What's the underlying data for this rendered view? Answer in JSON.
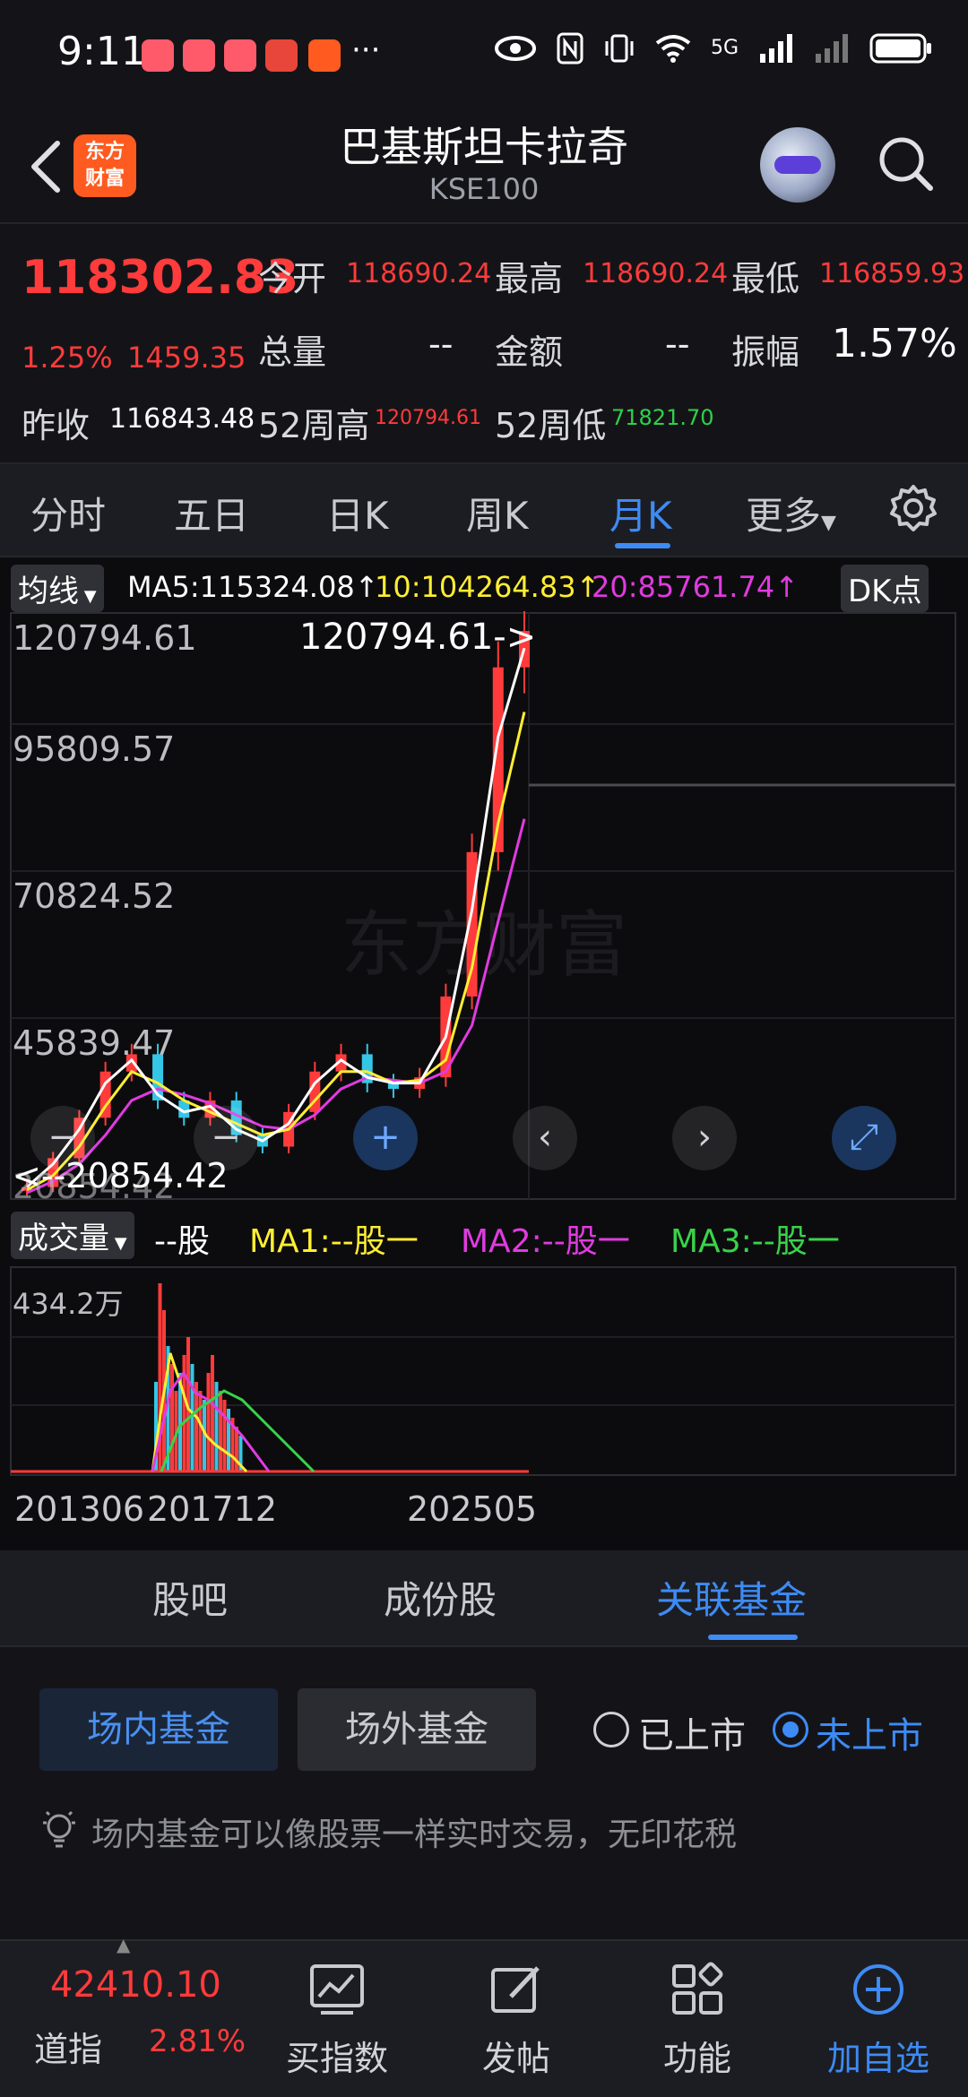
{
  "status_bar": {
    "time": "9:11",
    "more": "···",
    "net": "5G"
  },
  "header": {
    "back_label": "<",
    "logo_line1": "东方",
    "logo_line2": "财富",
    "title": "巴基斯坦卡拉奇",
    "subtitle": "KSE100"
  },
  "quote": {
    "price": "118302.83",
    "change_pct": "1.25%",
    "change_amt": "1459.35",
    "fields": [
      {
        "label": "今开",
        "value": "118690.24"
      },
      {
        "label": "最高",
        "value": "118690.24"
      },
      {
        "label": "最低",
        "value": "116859.93"
      },
      {
        "label": "总量",
        "value": "--"
      },
      {
        "label": "金额",
        "value": "--"
      },
      {
        "label": "振幅",
        "value": "1.57%"
      },
      {
        "label": "昨收",
        "value": "116843.48"
      },
      {
        "label": "52周高",
        "value": "120794.61"
      },
      {
        "label": "52周低",
        "value": "71821.70"
      }
    ]
  },
  "period_tabs": [
    "分时",
    "五日",
    "日K",
    "周K",
    "月K",
    "更多"
  ],
  "chart": {
    "ma_selector": "均线",
    "ma5": "MA5:115324.08↑",
    "ma10": "10:104264.83↑",
    "ma20": "20:85761.74↑",
    "dk_button": "DK点",
    "y_labels": [
      "120794.61",
      "95809.57",
      "70824.52",
      "45839.47",
      "20854.42"
    ],
    "high_marker": "120794.61->",
    "low_marker": "<--20854.42",
    "watermark": "东方财富",
    "volume_selector": "成交量",
    "vol_unit": "--股",
    "vol_ma1": "MA1:--股一",
    "vol_ma2": "MA2:--股一",
    "vol_ma3": "MA3:--股一",
    "vol_max": "434.2万",
    "x_labels": [
      "201306",
      "201712",
      "202505"
    ],
    "colors": {
      "up": "#ff3b3b",
      "down": "#35c6e6",
      "ma5": "#ffffff",
      "ma10": "#ffee33",
      "ma20": "#e03be0",
      "vol_ma3": "#39d34a"
    }
  },
  "section_tabs": [
    "股吧",
    "成份股",
    "关联基金"
  ],
  "fund": {
    "btn_onsite": "场内基金",
    "btn_offsite": "场外基金",
    "radio_listed": "已上市",
    "radio_unlisted": "未上市",
    "tip": "场内基金可以像股票一样实时交易，无印花税"
  },
  "bottom_nav": {
    "index_value": "42410.10",
    "index_name": "道指",
    "index_change": "2.81%",
    "items": [
      "买指数",
      "发帖",
      "功能",
      "加自选"
    ]
  },
  "chart_data": {
    "type": "candlestick",
    "title": "",
    "ylim": [
      20854.42,
      120794.61
    ],
    "x_ticks": [
      "201306",
      "201712",
      "202505"
    ],
    "series": [
      {
        "name": "MA5",
        "values": [
          22000,
          26000,
          32000,
          40000,
          44000,
          38000,
          35000,
          36000,
          32000,
          30000,
          33000,
          40000,
          44000,
          41000,
          40000,
          40000,
          48000,
          70000,
          100000,
          115324.08
        ]
      },
      {
        "name": "10",
        "values": [
          21500,
          24000,
          29000,
          36000,
          42000,
          40000,
          37000,
          35000,
          33000,
          31000,
          32000,
          37000,
          42000,
          42000,
          40000,
          40500,
          44000,
          60000,
          85000,
          104264.83
        ]
      },
      {
        "name": "20",
        "values": [
          21000,
          23000,
          26000,
          31000,
          37000,
          39000,
          38000,
          36500,
          34500,
          32500,
          32000,
          34500,
          39000,
          41000,
          40500,
          40000,
          42000,
          50000,
          68000,
          85761.74
        ]
      }
    ],
    "close": [
      22000,
      27000,
      34000,
      42000,
      45000,
      37000,
      34000,
      37000,
      31000,
      29000,
      35000,
      42000,
      45000,
      40000,
      39000,
      41000,
      55000,
      80000,
      112000,
      118302.83
    ]
  }
}
